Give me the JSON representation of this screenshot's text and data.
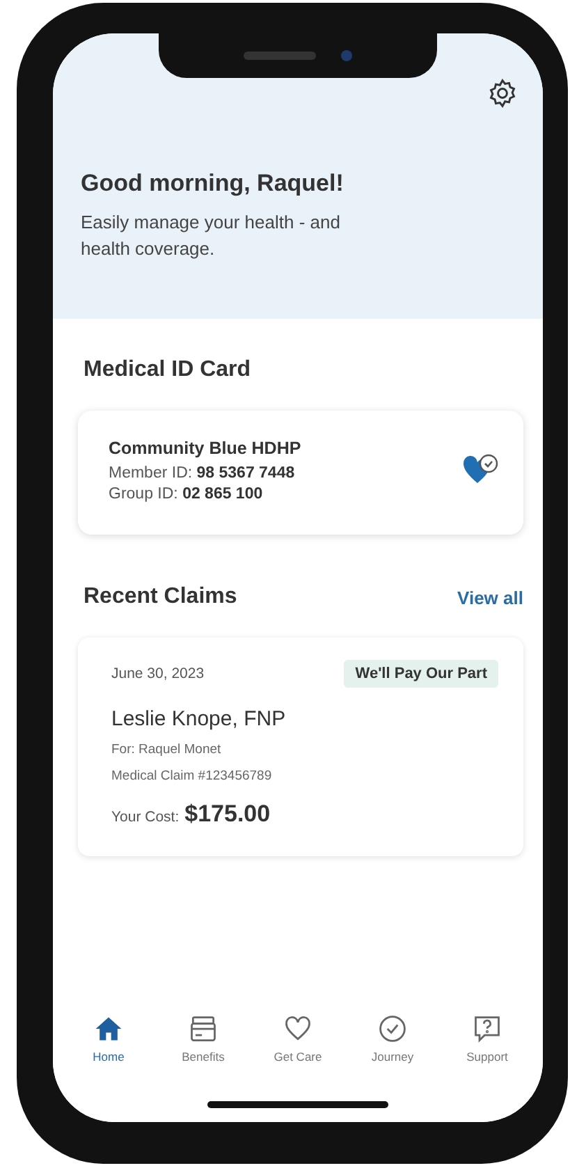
{
  "greeting": {
    "title": "Good morning, Raquel!",
    "subtitle": "Easily manage your health - and health coverage."
  },
  "id_card": {
    "heading": "Medical ID Card",
    "plan": "Community Blue HDHP",
    "member_label": "Member ID:",
    "member_id": "98 5367 7448",
    "group_label": "Group ID:",
    "group_id": "02 865 100"
  },
  "claims": {
    "heading": "Recent Claims",
    "view_all": "View all",
    "items": [
      {
        "date": "June 30, 2023",
        "status": "We'll Pay Our Part",
        "provider": "Leslie Knope, FNP",
        "for": "For: Raquel Monet",
        "claim": "Medical Claim #123456789",
        "cost_label": "Your Cost:",
        "cost": "$175.00"
      }
    ]
  },
  "tabs": [
    {
      "label": "Home",
      "kind": "home",
      "selected": true
    },
    {
      "label": "Benefits",
      "kind": "cards",
      "selected": false
    },
    {
      "label": "Get Care",
      "kind": "heart",
      "selected": false
    },
    {
      "label": "Journey",
      "kind": "check",
      "selected": false
    },
    {
      "label": "Support",
      "kind": "help",
      "selected": false
    }
  ]
}
